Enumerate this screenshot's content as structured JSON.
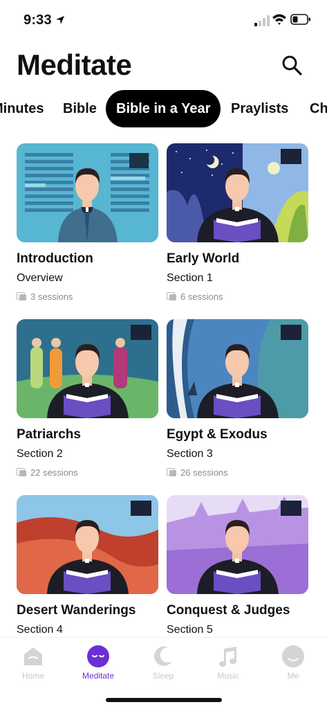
{
  "status_bar": {
    "time": "9:33"
  },
  "header": {
    "title": "Meditate"
  },
  "tabs": [
    {
      "label": "Minutes"
    },
    {
      "label": "Bible"
    },
    {
      "label": "Bible in a Year"
    },
    {
      "label": "Praylists"
    },
    {
      "label": "Ch"
    }
  ],
  "cards": [
    {
      "title": "Introduction",
      "subtitle": "Overview",
      "sessions": "3 sessions"
    },
    {
      "title": "Early World",
      "subtitle": "Section 1",
      "sessions": "6 sessions"
    },
    {
      "title": "Patriarchs",
      "subtitle": "Section 2",
      "sessions": "22 sessions"
    },
    {
      "title": "Egypt & Exodus",
      "subtitle": "Section 3",
      "sessions": "26 sessions"
    },
    {
      "title": "Desert Wanderings",
      "subtitle": "Section 4",
      "sessions": ""
    },
    {
      "title": "Conquest & Judges",
      "subtitle": "Section 5",
      "sessions": ""
    }
  ],
  "tabbar": [
    {
      "label": "Home"
    },
    {
      "label": "Meditate"
    },
    {
      "label": "Sleep"
    },
    {
      "label": "Music"
    },
    {
      "label": "Me"
    }
  ],
  "colors": {
    "accent": "#6b2fd6",
    "inactive": "#c8c8c8",
    "tab_active_bg": "#000000"
  }
}
